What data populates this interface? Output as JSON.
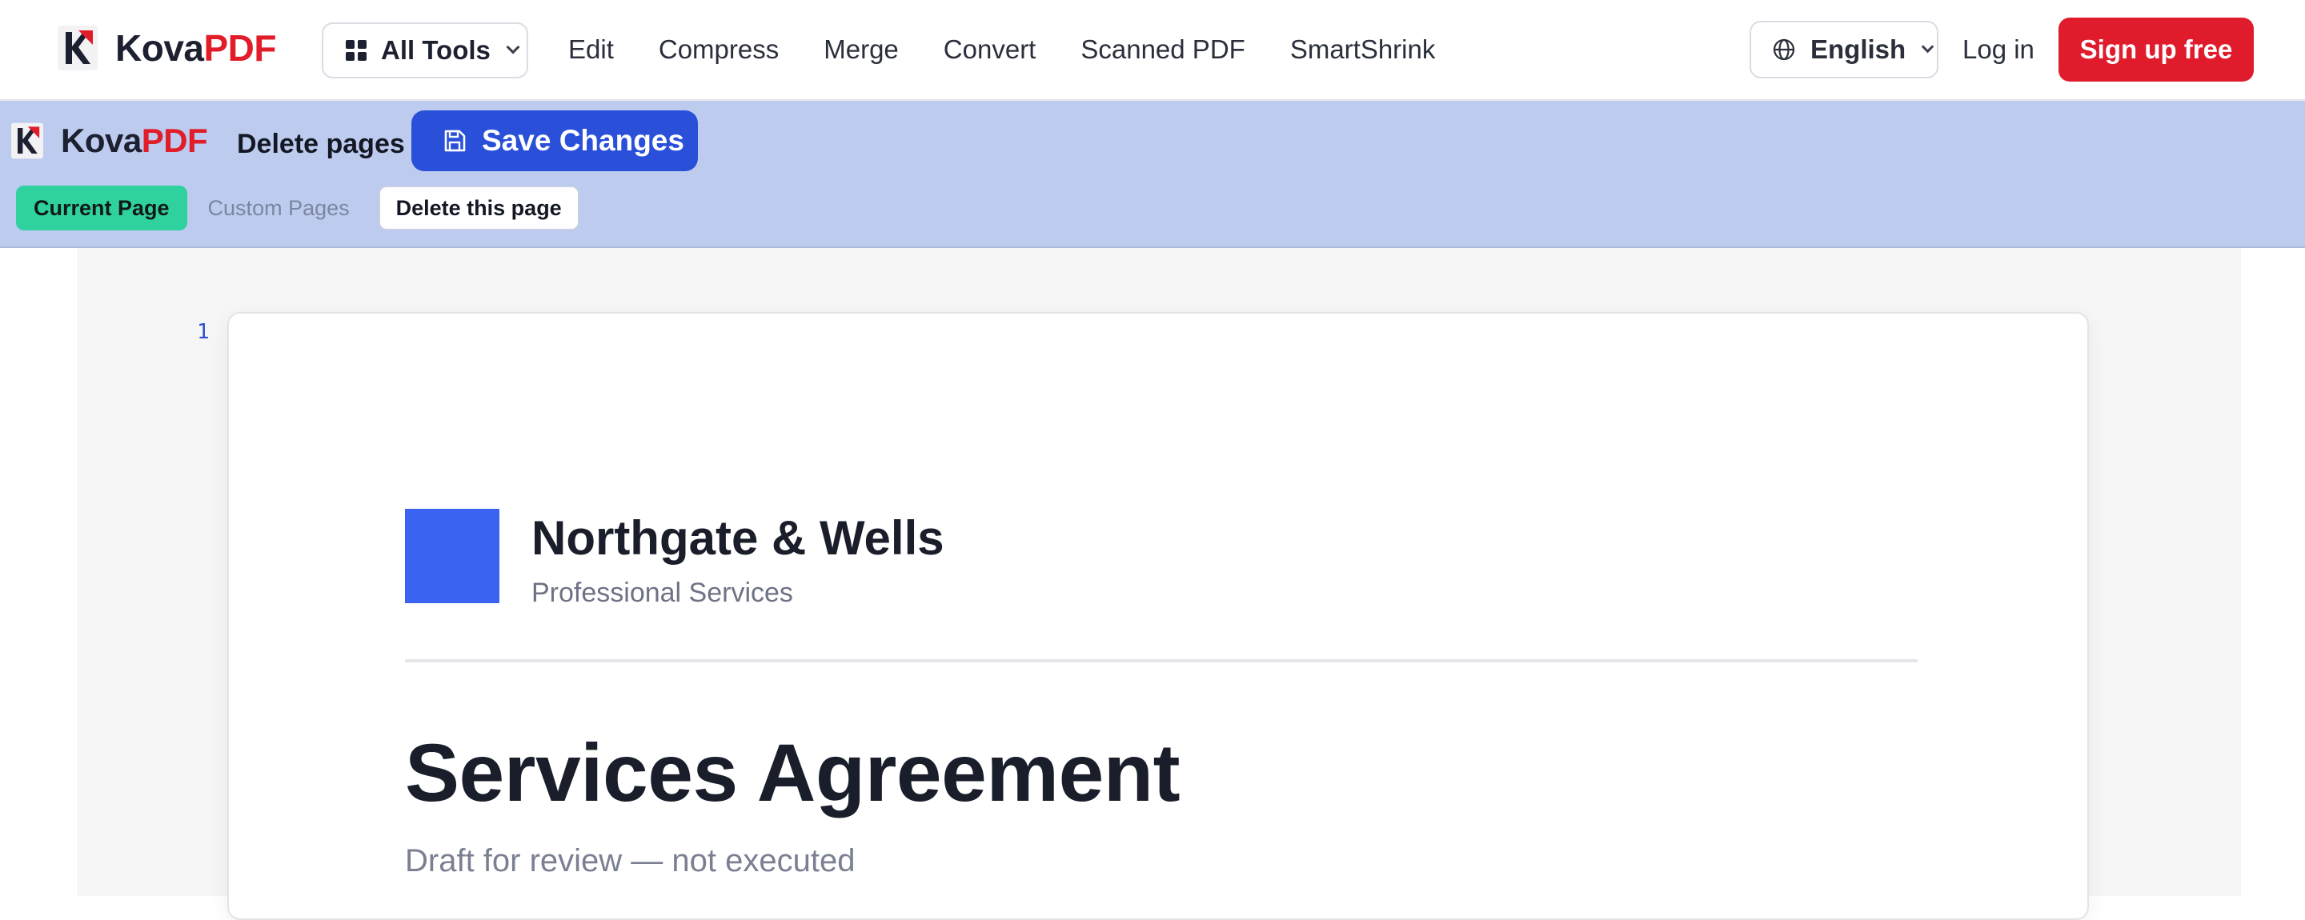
{
  "brand": {
    "name_part1": "Kova",
    "name_part2": "PDF",
    "accent": "#e11d2a",
    "logo_icon": "kovapdf-logo-icon"
  },
  "header": {
    "all_tools_label": "All Tools",
    "nav": [
      "Edit",
      "Compress",
      "Merge",
      "Convert",
      "Scanned PDF",
      "SmartShrink"
    ],
    "language_label": "English",
    "login_label": "Log in",
    "signup_label": "Sign up free",
    "signup_color": "#e01b2c"
  },
  "editor": {
    "tool_title": "Delete pages",
    "save_label": "Save Changes",
    "save_color": "#2a4fd9",
    "toolbar_bg": "#bccbee",
    "tabs": {
      "current": "Current Page",
      "custom": "Custom Pages"
    },
    "delete_this_page_label": "Delete this page"
  },
  "document": {
    "page_number": "1",
    "company_name": "Northgate & Wells",
    "company_tagline": "Professional Services",
    "title": "Services Agreement",
    "subtitle": "Draft for review — not executed",
    "logo_color": "#3a63f2"
  }
}
